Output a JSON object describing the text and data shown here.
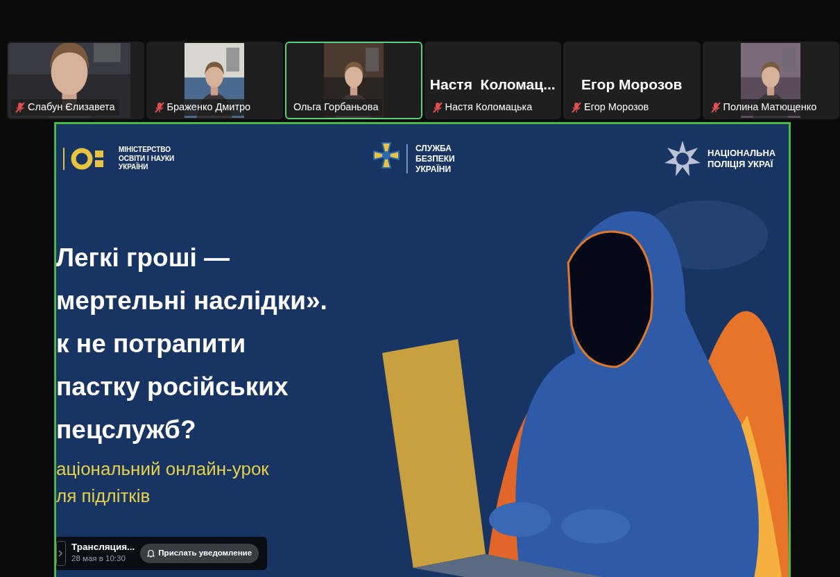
{
  "participants": [
    {
      "name": "Слабун Єлизавета",
      "kind": "wide_video",
      "muted": true,
      "speaking": false
    },
    {
      "name": "Браженко Дмитро",
      "kind": "video",
      "muted": true,
      "speaking": false
    },
    {
      "name": "Ольга Горбаньова",
      "kind": "video",
      "muted": false,
      "speaking": true
    },
    {
      "name": "Настя Коломацька",
      "display_name": "Настя  Коломац...",
      "kind": "name_only",
      "muted": true,
      "speaking": false
    },
    {
      "name": "Егор Морозов",
      "display_name": "Егор Морозов",
      "kind": "name_only",
      "muted": true,
      "speaking": false
    },
    {
      "name": "Полина Матющенко",
      "kind": "video",
      "muted": true,
      "speaking": false
    }
  ],
  "shared_screen": {
    "speaking": true,
    "slide": {
      "logos": [
        {
          "kind": "ministry",
          "lines": [
            "МІНІСТЕРСТВО",
            "ОСВІТИ І НАУКИ",
            "УКРАЇНИ"
          ]
        },
        {
          "kind": "security",
          "lines": [
            "СЛУЖБА",
            "БЕЗПЕКИ",
            "УКРАЇНИ"
          ]
        },
        {
          "kind": "police",
          "lines": [
            "НАЦІОНАЛЬНА",
            "ПОЛІЦІЯ УКРАЇ"
          ]
        }
      ],
      "headline": [
        "Легкі гроші —",
        "мертельні наслідки».",
        "к не потрапити",
        "пастку російських",
        "пецслужб?"
      ],
      "subtitle": [
        "аціональний онлайн-урок",
        "ля підлітків"
      ],
      "illustration": {
        "kind": "picture"
      }
    },
    "broadcast": {
      "title": "Трансляция...",
      "time": "28 мая в 10:30",
      "button": "Прислать уведомление"
    }
  }
}
